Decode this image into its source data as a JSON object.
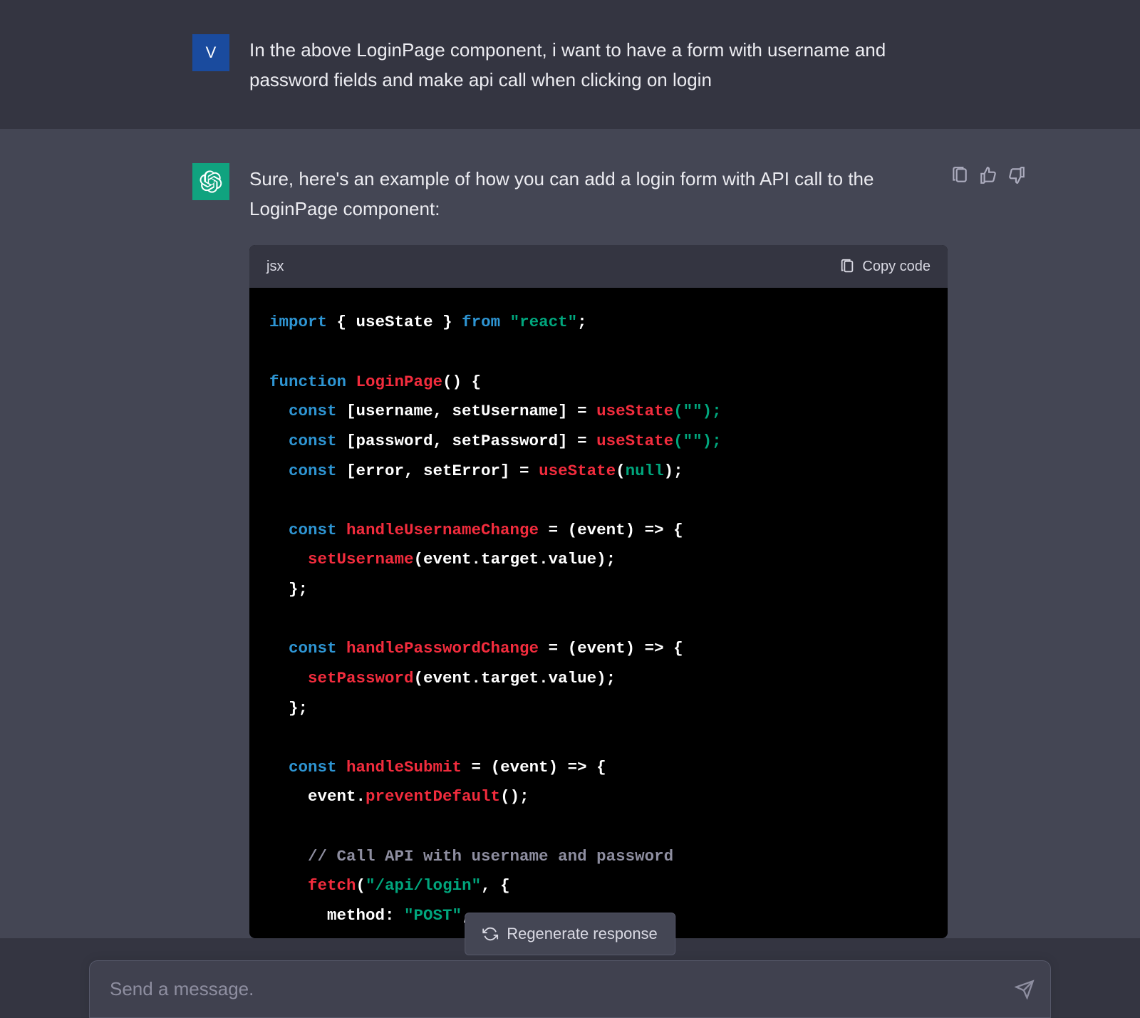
{
  "user": {
    "avatar_initial": "V",
    "message": "In the above LoginPage component, i want to have a form with username and password fields and make api call when clicking on login"
  },
  "assistant": {
    "intro": "Sure, here's an example of how you can add a login form with API call to the LoginPage component:",
    "code_lang": "jsx",
    "copy_label": "Copy code",
    "code": {
      "l1": {
        "import": "import",
        "brace_open": " { ",
        "useState": "useState",
        "brace_close": " } ",
        "from": "from",
        "react": " \"react\"",
        "semi": ";"
      },
      "l2": {
        "function": "function",
        "name": " LoginPage",
        "parens": "() {"
      },
      "l3": {
        "const": "  const",
        "dest": " [username, setUsername] = ",
        "call": "useState",
        "args": "(\"\");"
      },
      "l4": {
        "const": "  const",
        "dest": " [password, setPassword] = ",
        "call": "useState",
        "args": "(\"\");"
      },
      "l5": {
        "const": "  const",
        "dest": " [error, setError] = ",
        "call": "useState",
        "open": "(",
        "null": "null",
        "close": ");"
      },
      "l6": {
        "const": "  const",
        "name": " handleUsernameChange",
        "eq": " = ",
        "params": "(event)",
        "arrow": " => {"
      },
      "l7": {
        "call": "    setUsername",
        "args": "(event.target.value);"
      },
      "l8": {
        "close": "  };"
      },
      "l9": {
        "const": "  const",
        "name": " handlePasswordChange",
        "eq": " = ",
        "params": "(event)",
        "arrow": " => {"
      },
      "l10": {
        "call": "    setPassword",
        "args": "(event.target.value);"
      },
      "l11": {
        "close": "  };"
      },
      "l12": {
        "const": "  const",
        "name": " handleSubmit",
        "eq": " = ",
        "params": "(event)",
        "arrow": " => {"
      },
      "l13": {
        "obj": "    event.",
        "call": "preventDefault",
        "args": "();"
      },
      "l14": {
        "comment": "    // Call API with username and password"
      },
      "l15": {
        "call": "    fetch",
        "open": "(",
        "str": "\"/api/login\"",
        "rest": ", {"
      },
      "l16": {
        "key": "      method",
        "colon": ": ",
        "str": "\"POST\"",
        "comma": ","
      }
    }
  },
  "regenerate_label": "Regenerate response",
  "input_placeholder": "Send a message."
}
